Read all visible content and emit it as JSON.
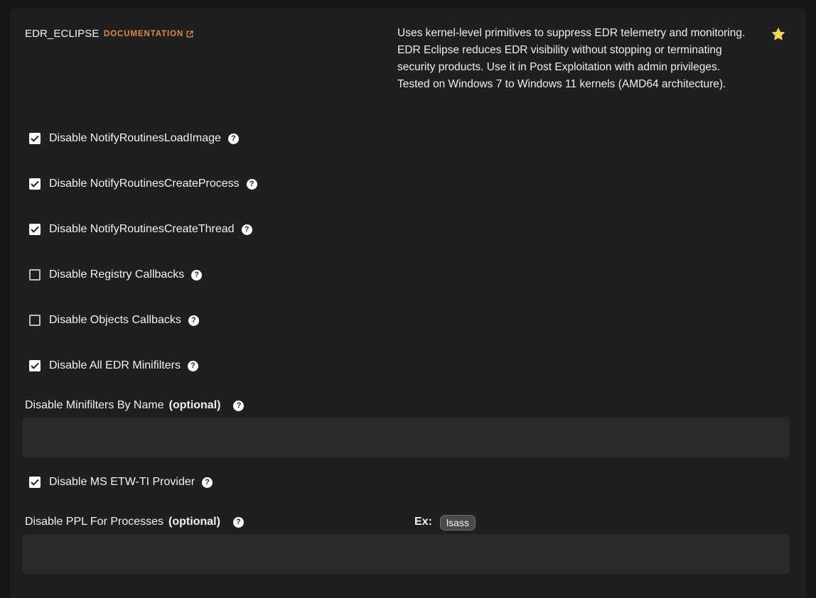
{
  "module": {
    "title": "EDR_ECLIPSE",
    "documentation_label": "DOCUMENTATION",
    "description": "Uses kernel-level primitives to suppress EDR telemetry and monitoring. EDR Eclipse reduces EDR visibility without stopping or terminating security products. Use it in Post Exploitation with admin privileges. Tested on Windows 7 to Windows 11 kernels (AMD64 architecture).",
    "favorite": true,
    "accent_color": "#e08a3c",
    "star_color": "#f5d94a"
  },
  "options": [
    {
      "label": "Disable NotifyRoutinesLoadImage",
      "checked": true
    },
    {
      "label": "Disable NotifyRoutinesCreateProcess",
      "checked": true
    },
    {
      "label": "Disable NotifyRoutinesCreateThread",
      "checked": true
    },
    {
      "label": "Disable Registry Callbacks",
      "checked": false
    },
    {
      "label": "Disable Objects Callbacks",
      "checked": false
    },
    {
      "label": "Disable All EDR Minifilters",
      "checked": true
    }
  ],
  "minifilters_field": {
    "label": "Disable Minifilters By Name",
    "optional_label": "(optional)",
    "value": "",
    "placeholder": ""
  },
  "etw_option": {
    "label": "Disable MS ETW-TI Provider",
    "checked": true
  },
  "ppl_field": {
    "label": "Disable PPL For Processes",
    "optional_label": "(optional)",
    "example_label": "Ex:",
    "example_chip": "lsass",
    "value": "",
    "placeholder": ""
  },
  "help_icon_glyph": "?"
}
